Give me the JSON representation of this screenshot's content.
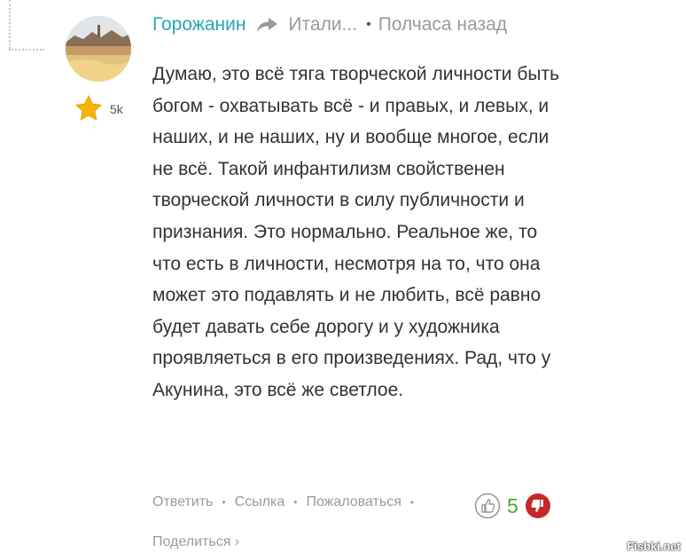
{
  "comment": {
    "author": "Горожанин",
    "reply_to": "Итали...",
    "time": "Полчаса назад",
    "rating": "5k",
    "text": "Думаю, это всё тяга творческой личности быть богом - охватывать всё - и правых, и левых, и наших, и не наших, ну и вообще многое, если не всё. Такой инфантилизм свойственен творческой личности в силу публичности и признания. Это нормально. Реальное же, то что есть в личности, несмотря на то, что она может это подавлять и не любить, всё равно будет давать себе дорогу и у художника проявляеться в его произведениях. Рад, что у Акунина, это всё же светлое."
  },
  "actions": {
    "reply": "Ответить",
    "link": "Ссылка",
    "report": "Пожаловаться",
    "share": "Поделиться ›"
  },
  "votes": {
    "score": "5"
  },
  "icons": [
    "reply-arrow-icon",
    "star-icon",
    "thumbs-up-icon",
    "thumbs-down-icon"
  ],
  "colors": {
    "author": "#27a7b0",
    "score": "#4caa36",
    "dislike": "#c62828",
    "star": "#f5b400"
  },
  "watermark": "Fishki.net"
}
